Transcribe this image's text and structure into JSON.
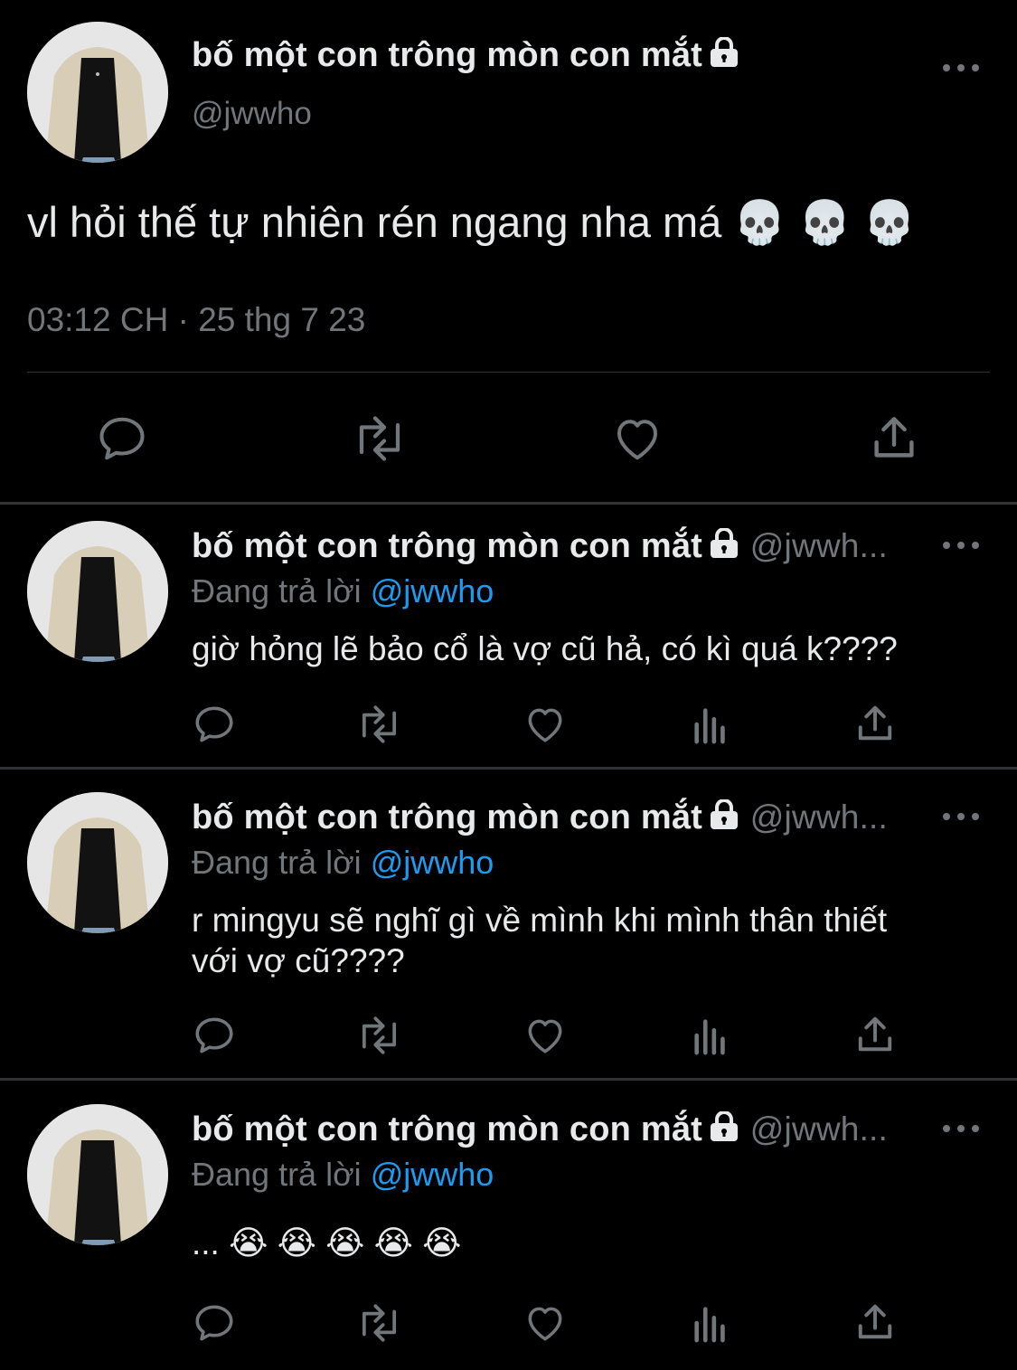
{
  "main_tweet": {
    "display_name": "bố một con trông mòn con mắt",
    "handle": "@jwwho",
    "text": "vl hỏi thế tự nhiên rén ngang nha má 💀 💀 💀",
    "time": "03:12 CH",
    "separator": "·",
    "date": "25 thg 7 23"
  },
  "replies": [
    {
      "display_name": "bố một con trông mòn con mắt",
      "handle": "@jwwh...",
      "replying_prefix": "Đang trả lời",
      "replying_to": "@jwwho",
      "text_lines": [
        "giờ hỏng lẽ bảo cổ là vợ cũ hả, có kì quá k????"
      ]
    },
    {
      "display_name": "bố một con trông mòn con mắt",
      "handle": "@jwwh...",
      "replying_prefix": "Đang trả lời",
      "replying_to": "@jwwho",
      "text_lines": [
        "r mingyu sẽ nghĩ gì về mình khi mình thân thiết",
        "với vợ cũ????"
      ]
    },
    {
      "display_name": "bố một con trông mòn con mắt",
      "handle": "@jwwh...",
      "replying_prefix": "Đang trả lời",
      "replying_to": "@jwwho",
      "text_lines": [
        "... 😭 😭 😭 😭 😭"
      ]
    }
  ],
  "icons": {
    "lock": "lock-icon",
    "more": "more-icon",
    "reply": "reply-icon",
    "retweet": "retweet-icon",
    "like": "like-icon",
    "views": "views-icon",
    "share": "share-icon"
  },
  "colors": {
    "background": "#000000",
    "text": "#e7e9ea",
    "secondary": "#71767b",
    "mention": "#1d9bf0",
    "divider": "#2f3336"
  }
}
